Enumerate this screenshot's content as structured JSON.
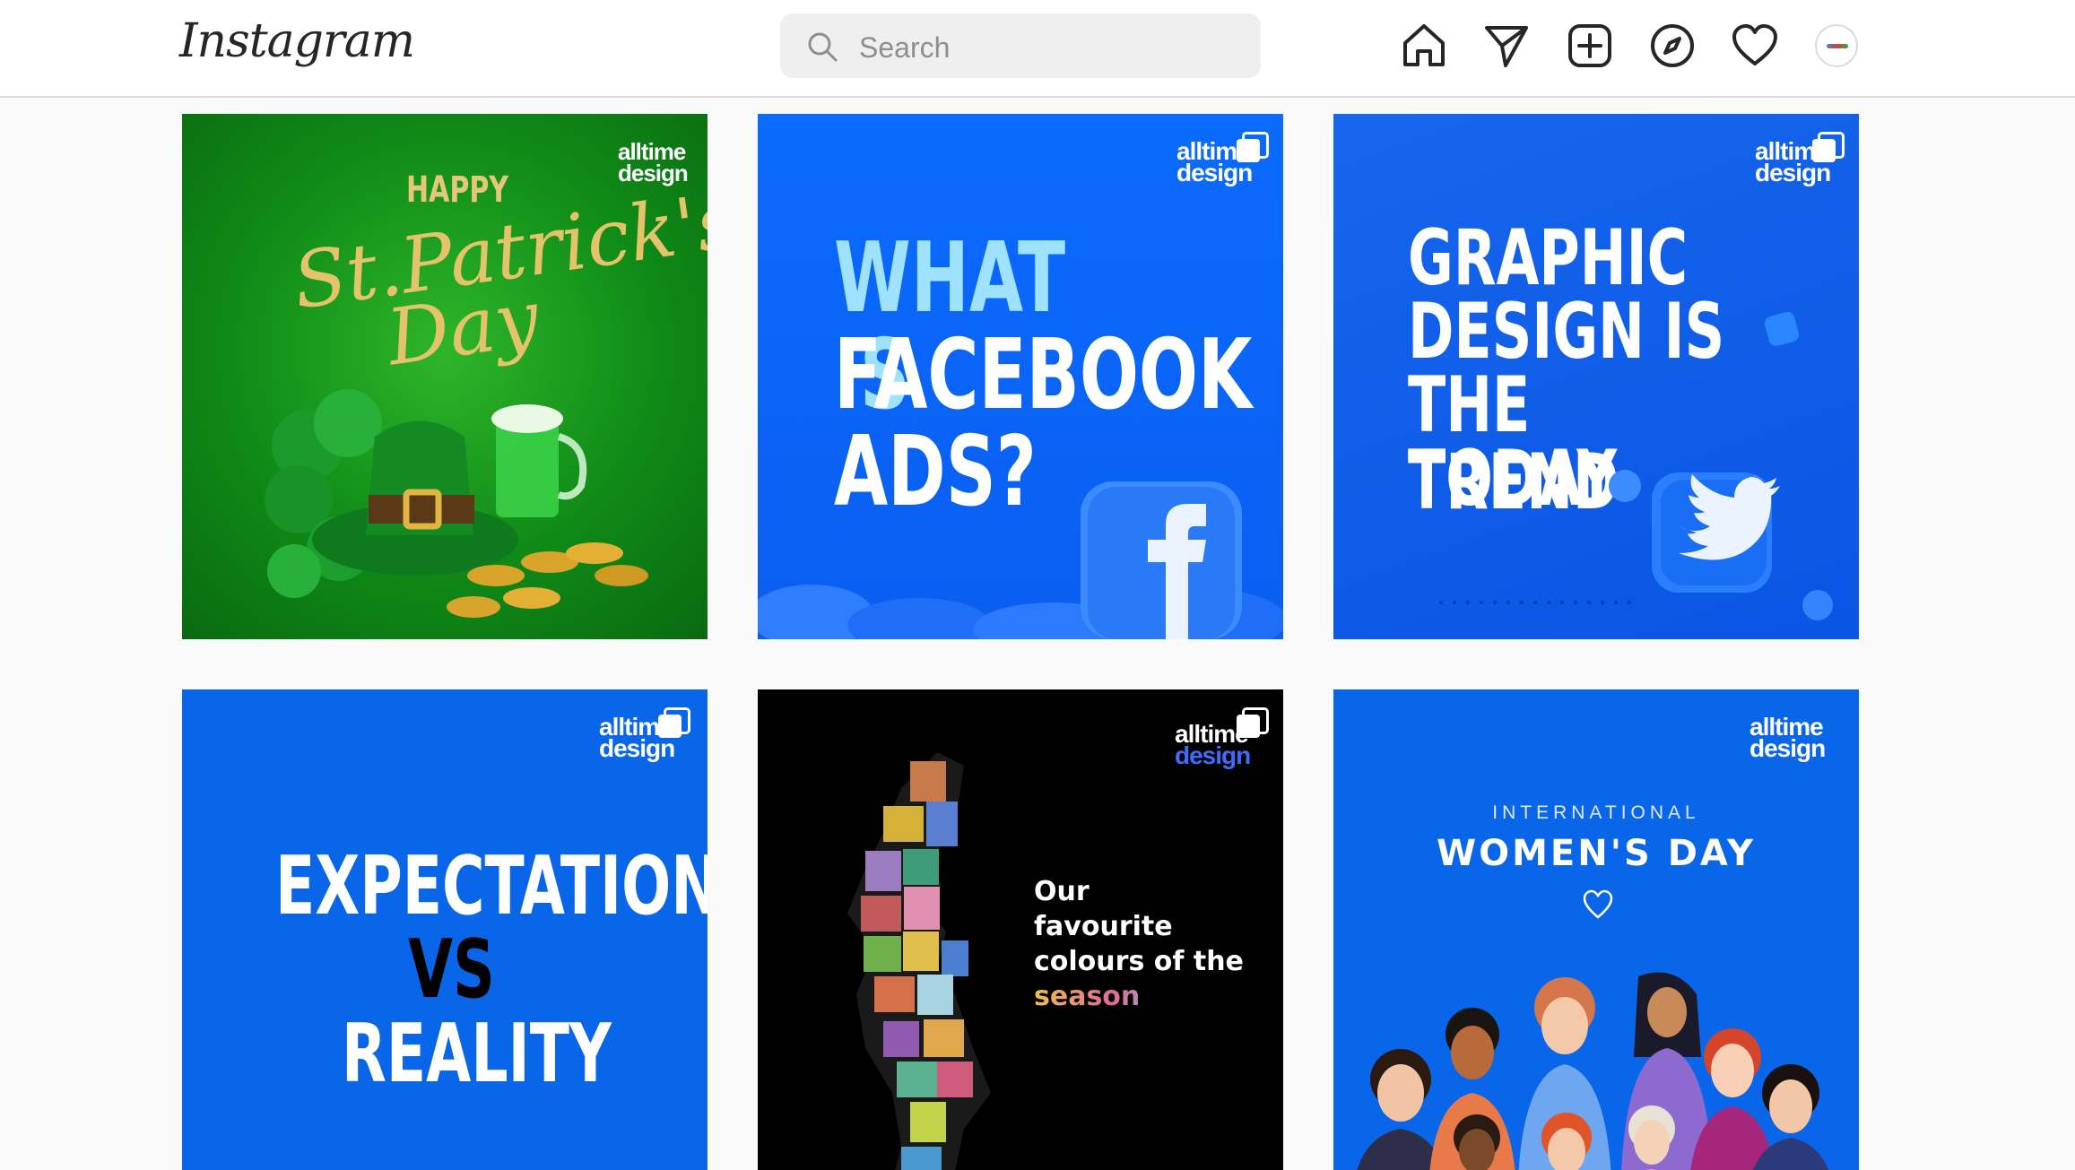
{
  "app": {
    "logo_text": "Instagram",
    "search": {
      "placeholder": "Search"
    }
  },
  "nav": {
    "icons": [
      "home-icon",
      "direct-messages-icon",
      "new-post-icon",
      "explore-icon",
      "activity-icon",
      "profile-avatar"
    ]
  },
  "colors": {
    "header_bg": "#ffffff",
    "page_bg": "#fafafa",
    "brand_blue": "#0a66e8",
    "st_patrick_green": "#11901b"
  },
  "posts": [
    {
      "brand_line1": "alltime",
      "brand_line2": "design",
      "line1": "HAPPY",
      "line2": "St.Patrick's",
      "line3": "Day"
    },
    {
      "brand_line1": "alltime",
      "brand_line2": "design",
      "line1": "WHAT IS",
      "line2": "FACEBOOK",
      "line3": "ADS?"
    },
    {
      "brand_line1": "alltime",
      "brand_line2": "design",
      "line1": "GRAPHIC",
      "line2": "DESIGN IS",
      "line3": "THE TREND",
      "line4": "TODAY"
    },
    {
      "brand_line1": "alltime",
      "brand_line2": "design",
      "line1": "EXPECTATION",
      "line2": "VS",
      "line3": "REALITY"
    },
    {
      "brand_line1": "alltime",
      "brand_line2": "design",
      "line1": "Our",
      "line2": "favourite",
      "line3": "colours of the",
      "line4": "season"
    },
    {
      "brand_line1": "alltime",
      "brand_line2": "design",
      "line1": "INTERNATIONAL",
      "line2": "WOMEN'S DAY"
    }
  ]
}
